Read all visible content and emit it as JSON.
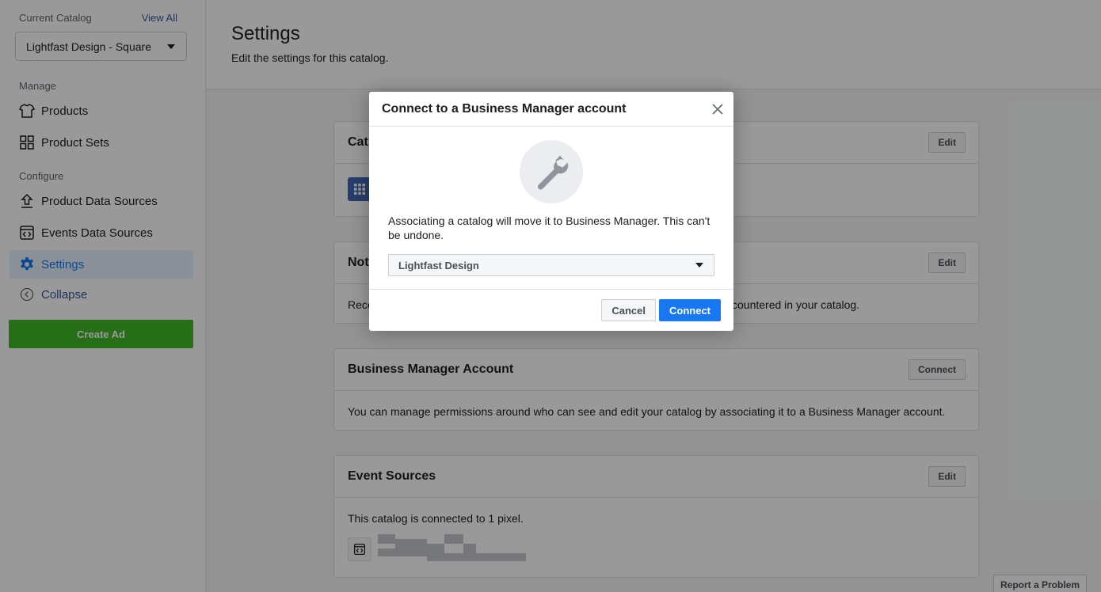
{
  "sidebar": {
    "current_catalog_label": "Current Catalog",
    "view_all": "View All",
    "catalog_selected": "Lightfast Design - Square",
    "manage_label": "Manage",
    "configure_label": "Configure",
    "items": [
      {
        "label": "Products",
        "icon": "tshirt-icon"
      },
      {
        "label": "Product Sets",
        "icon": "grid-icon"
      },
      {
        "label": "Product Data Sources",
        "icon": "upload-icon"
      },
      {
        "label": "Events Data Sources",
        "icon": "code-window-icon"
      },
      {
        "label": "Settings",
        "icon": "gear-icon",
        "active": true
      },
      {
        "label": "Collapse",
        "icon": "chevron-left-circle-icon"
      }
    ],
    "create_ad": "Create Ad"
  },
  "header": {
    "title": "Settings",
    "subtitle": "Edit the settings for this catalog."
  },
  "cards": {
    "catalog": {
      "title": "Cat",
      "button": "Edit"
    },
    "notifications": {
      "title": "Not",
      "button": "Edit",
      "body_left": "Rece",
      "body_right": "countered in your catalog."
    },
    "business_manager": {
      "title": "Business Manager Account",
      "button": "Connect",
      "body": "You can manage permissions around who can see and edit your catalog by associating it to a Business Manager account."
    },
    "event_sources": {
      "title": "Event Sources",
      "button": "Edit",
      "body": "This catalog is connected to 1 pixel."
    }
  },
  "modal": {
    "title": "Connect to a Business Manager account",
    "text": "Associating a catalog will move it to Business Manager. This can't be undone.",
    "select_value": "Lightfast Design",
    "cancel": "Cancel",
    "connect": "Connect"
  },
  "report_problem": "Report a Problem",
  "colors": {
    "accent": "#1877f2",
    "create_ad_green": "#42b72a",
    "link": "#385898"
  }
}
